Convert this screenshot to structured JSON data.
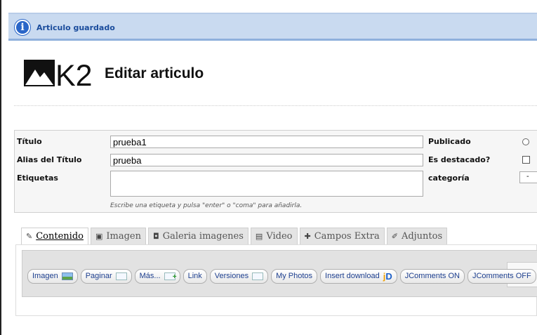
{
  "message": {
    "text": "Articulo guardado",
    "icon": "info-icon"
  },
  "header": {
    "logo_text": "K2",
    "title": "Editar articulo"
  },
  "form": {
    "title_label": "Título",
    "title_value": "prueba1",
    "alias_label": "Alias del Título",
    "alias_value": "prueba",
    "tags_label": "Etiquetas",
    "tags_hint": "Escribe una etiqueta y pulsa \"enter\" o \"coma\" para añadirla.",
    "published_label": "Publicado",
    "featured_label": "Es destacado?",
    "category_label": "categoría",
    "category_value": "-"
  },
  "tabs": [
    {
      "label": "Contenido",
      "icon": "edit-icon"
    },
    {
      "label": "Imagen",
      "icon": "image-icon"
    },
    {
      "label": "Galeria imagenes",
      "icon": "camera-icon"
    },
    {
      "label": "Video",
      "icon": "film-icon"
    },
    {
      "label": "Campos Extra",
      "icon": "puzzle-icon"
    },
    {
      "label": "Adjuntos",
      "icon": "paperclip-icon"
    }
  ],
  "editor_buttons": [
    "Imagen",
    "Paginar",
    "Más...",
    "Link",
    "Versiones",
    "My Photos",
    "Insert download",
    "JComments ON",
    "JComments OFF"
  ],
  "colors": {
    "message_bg": "#c9daf0",
    "message_text": "#1a4c9c",
    "button_text": "#1d3f8f"
  }
}
